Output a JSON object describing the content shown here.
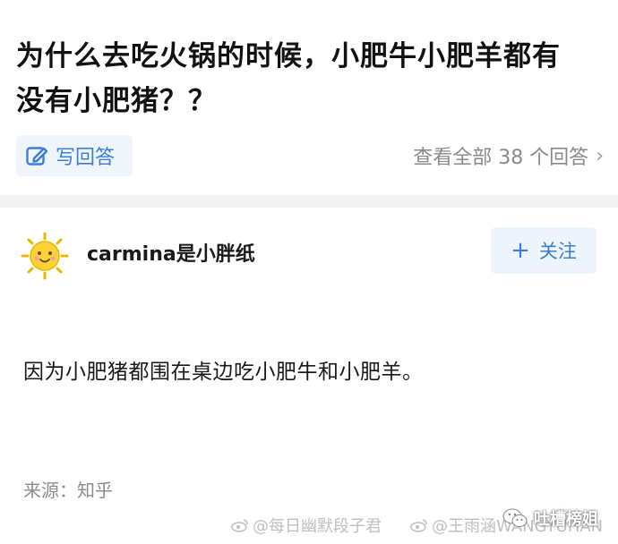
{
  "question": {
    "title": "为什么去吃火锅的时候，小肥牛小肥羊都有\n没有小肥猪？？",
    "write_answer_label": "写回答",
    "view_all_label": "查看全部 38 个回答"
  },
  "answer": {
    "author": "carmina是小胖纸",
    "follow_label": "关注",
    "text": "因为小肥猪都围在桌边吃小肥牛和小肥羊。",
    "source": "来源：知乎"
  },
  "watermarks": {
    "weibo_1": "@每日幽默段子君",
    "weibo_2": "@王雨涵WANGYUHAN",
    "wechat": "吐槽榜姐"
  },
  "colors": {
    "accent": "#3b7fd6",
    "divider": "#f2f2f2",
    "muted": "#8a8a8a"
  },
  "icons": {
    "write": "edit-pencil-icon",
    "chevron": "chevron-right-icon",
    "plus": "plus-icon",
    "avatar": "sun-face-avatar",
    "weibo": "weibo-icon",
    "wechat": "wechat-icon"
  }
}
